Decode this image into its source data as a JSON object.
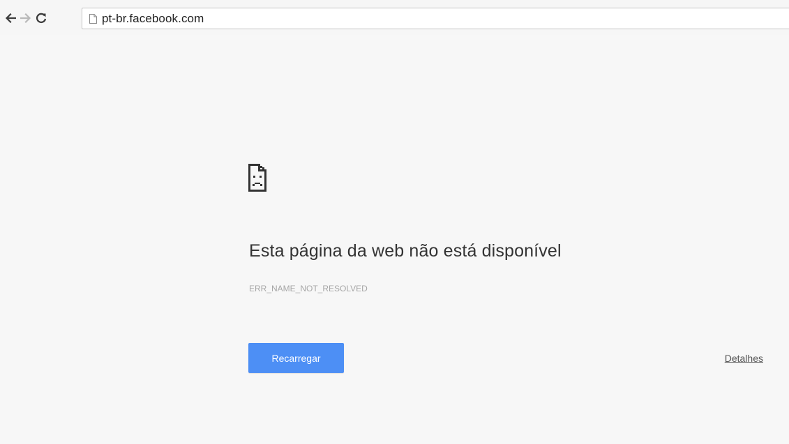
{
  "browser": {
    "address_bar": {
      "url": "pt-br.facebook.com"
    },
    "icons": {
      "back": "back-arrow-icon",
      "forward": "forward-arrow-icon",
      "reload": "reload-icon",
      "page": "page-icon"
    }
  },
  "error_page": {
    "icon": "sad-page-icon",
    "heading": "Esta página da web não está disponível",
    "error_code": "ERR_NAME_NOT_RESOLVED",
    "reload_button_label": "Recarregar",
    "details_link_label": "Detalhes"
  },
  "colors": {
    "background": "#f7f7f7",
    "button_blue": "#4d8ff5",
    "heading_text": "#333333",
    "error_code_text": "#a6a6a6"
  }
}
